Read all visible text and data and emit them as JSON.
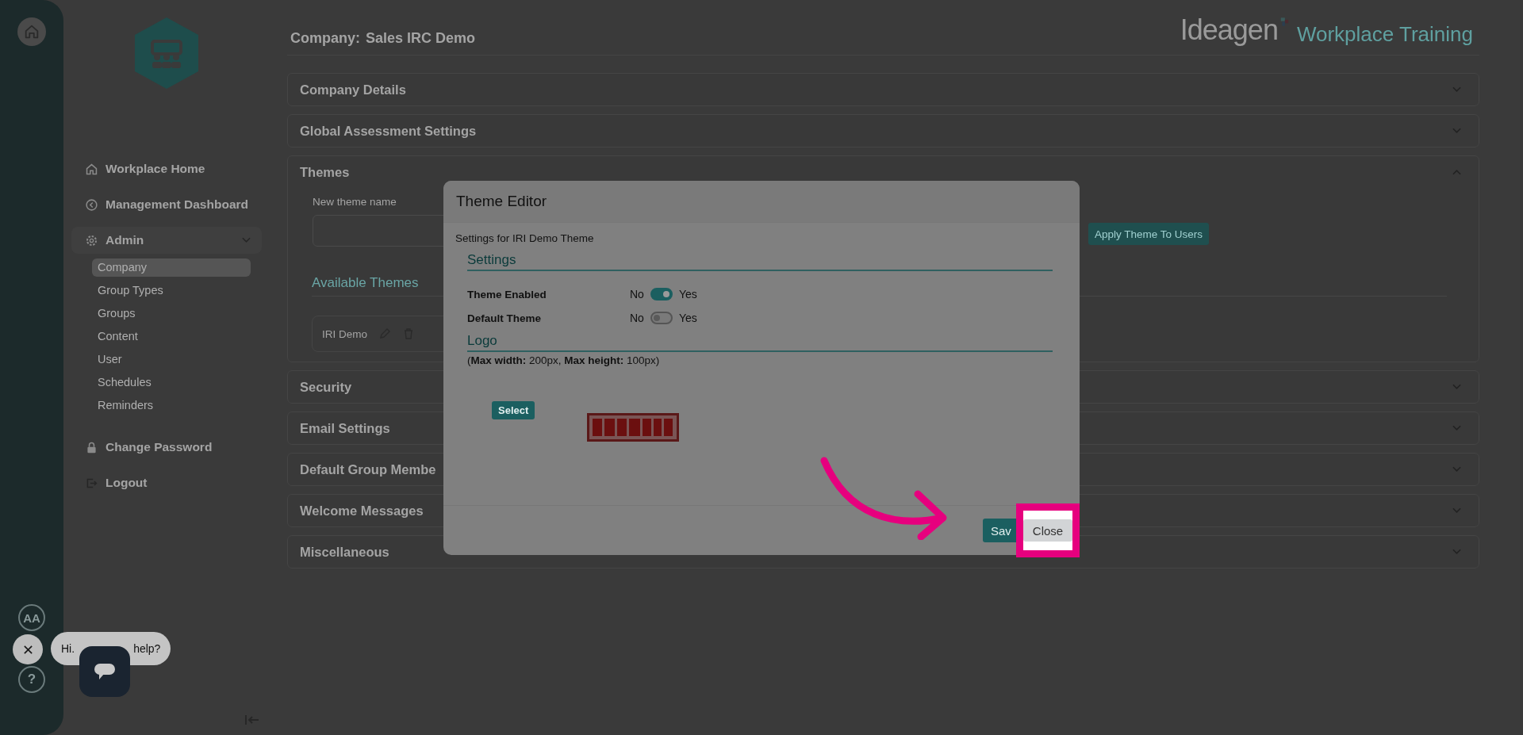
{
  "rail": {
    "avatar": "AA",
    "help": "?"
  },
  "sidebar": {
    "nav": [
      {
        "label": "Workplace Home"
      },
      {
        "label": "Management Dashboard"
      },
      {
        "label": "Admin",
        "expanded": true,
        "children": [
          {
            "label": "Company",
            "selected": true
          },
          {
            "label": "Group Types",
            "selected": false
          },
          {
            "label": "Groups",
            "selected": false
          },
          {
            "label": "Content",
            "selected": false
          },
          {
            "label": "User",
            "selected": false
          },
          {
            "label": "Schedules",
            "selected": false
          },
          {
            "label": "Reminders",
            "selected": false
          }
        ]
      },
      {
        "label": "Change Password"
      },
      {
        "label": "Logout"
      }
    ]
  },
  "header": {
    "company_label": "Company:",
    "company_name": "Sales IRC Demo",
    "brand": "Ideagen",
    "product": "Workplace Training"
  },
  "sections": [
    {
      "title": "Company Details",
      "expanded": false
    },
    {
      "title": "Global Assessment Settings",
      "expanded": false
    },
    {
      "title": "Themes",
      "expanded": true
    },
    {
      "title": "Security",
      "expanded": false
    },
    {
      "title": "Email Settings",
      "expanded": false
    },
    {
      "title": "Default Group Membe",
      "expanded": false
    },
    {
      "title": "Welcome Messages",
      "expanded": false
    },
    {
      "title": "Miscellaneous",
      "expanded": false
    }
  ],
  "themes": {
    "new_theme_label": "New theme name",
    "apply_button": "Apply Theme To Users",
    "available_heading": "Available Themes",
    "theme_cards": [
      {
        "name": "IRI Demo"
      }
    ]
  },
  "modal": {
    "title": "Theme Editor",
    "subtitle": "Settings for IRI Demo Theme",
    "settings_heading": "Settings",
    "toggles": [
      {
        "label": "Theme Enabled",
        "off_label": "No",
        "on_label": "Yes",
        "on": true
      },
      {
        "label": "Default Theme",
        "off_label": "No",
        "on_label": "Yes",
        "on": false
      }
    ],
    "logo_heading": "Logo",
    "limits": "(**Max width:** 200px,  **Max height:** 100px)",
    "select_button": "Select",
    "buttons": [
      {
        "label": "Sav",
        "kind": "primary"
      },
      {
        "label": "Close",
        "kind": "secondary"
      }
    ]
  },
  "chat": {
    "greeting_start": "Hi.",
    "greeting_end": "help?"
  }
}
